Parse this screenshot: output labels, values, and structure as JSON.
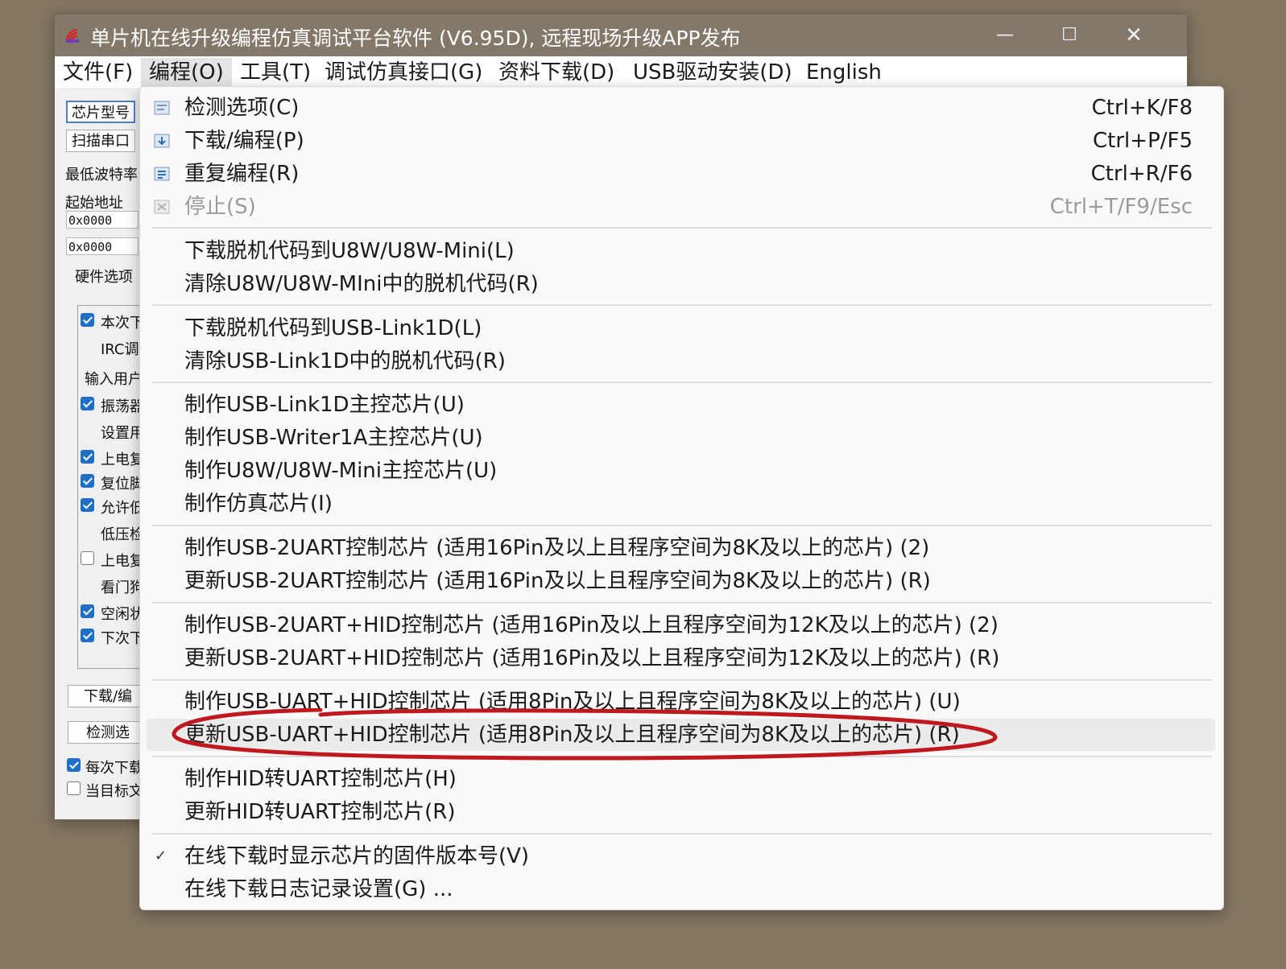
{
  "window": {
    "title": "单片机在线升级编程仿真调试平台软件 (V6.95D), 远程现场升级APP发布",
    "controls": {
      "minimize": "—",
      "maximize": "☐",
      "close": "✕"
    }
  },
  "menubar": [
    {
      "label": "文件(F)"
    },
    {
      "label": "编程(O)"
    },
    {
      "label": "工具(T)"
    },
    {
      "label": "调试仿真接口(G)"
    },
    {
      "label": "资料下载(D)"
    },
    {
      "label": "USB驱动安装(D)"
    },
    {
      "label": "English"
    }
  ],
  "panel": {
    "chip_model_button": "芯片型号",
    "scan_port_button": "扫描串口",
    "min_baud_label": "最低波特率",
    "start_address_label": "起始地址",
    "address1": "0x0000",
    "address2": "0x0000",
    "hardware_options_label": "硬件选项",
    "options": [
      {
        "text": "本次下",
        "checked": true
      },
      {
        "text": "IRC调",
        "checked": null
      },
      {
        "text": "输入用户",
        "checked": null
      },
      {
        "text": "振荡器",
        "checked": true
      },
      {
        "text": "设置用",
        "checked": null
      },
      {
        "text": "上电复",
        "checked": true
      },
      {
        "text": "复位脚",
        "checked": true
      },
      {
        "text": "允许低",
        "checked": true
      },
      {
        "text": "低压检",
        "checked": null
      },
      {
        "text": "上电复",
        "checked": false
      },
      {
        "text": "看门狗",
        "checked": null
      },
      {
        "text": "空闲状",
        "checked": true
      },
      {
        "text": "下次下",
        "checked": true
      }
    ],
    "download_button": "下载/编",
    "detect_button": "检测选",
    "every_download_check": "每次下载",
    "every_download_checked": true,
    "target_file_check": "当目标文",
    "target_file_checked": false
  },
  "dropdown": {
    "items": [
      {
        "label": "检测选项(C)",
        "shortcut": "Ctrl+K/F8",
        "icon": "detect-icon"
      },
      {
        "label": "下载/编程(P)",
        "shortcut": "Ctrl+P/F5",
        "icon": "download-icon"
      },
      {
        "label": "重复编程(R)",
        "shortcut": "Ctrl+R/F6",
        "icon": "repeat-program-icon"
      },
      {
        "label": "停止(S)",
        "shortcut": "Ctrl+T/F9/Esc",
        "icon": "stop-icon",
        "disabled": true
      },
      {
        "label": "下载脱机代码到U8W/U8W-Mini(L)"
      },
      {
        "label": "清除U8W/U8W-MIni中的脱机代码(R)"
      },
      {
        "label": "下载脱机代码到USB-Link1D(L)"
      },
      {
        "label": "清除USB-Link1D中的脱机代码(R)"
      },
      {
        "label": "制作USB-Link1D主控芯片(U)"
      },
      {
        "label": "制作USB-Writer1A主控芯片(U)"
      },
      {
        "label": "制作U8W/U8W-Mini主控芯片(U)"
      },
      {
        "label": "制作仿真芯片(I)"
      },
      {
        "label": "制作USB-2UART控制芯片 (适用16Pin及以上且程序空间为8K及以上的芯片) (2)"
      },
      {
        "label": "更新USB-2UART控制芯片 (适用16Pin及以上且程序空间为8K及以上的芯片) (R)"
      },
      {
        "label": "制作USB-2UART+HID控制芯片 (适用16Pin及以上且程序空间为12K及以上的芯片) (2)"
      },
      {
        "label": "更新USB-2UART+HID控制芯片 (适用16Pin及以上且程序空间为12K及以上的芯片) (R)"
      },
      {
        "label": "制作USB-UART+HID控制芯片 (适用8Pin及以上且程序空间为8K及以上的芯片) (U)"
      },
      {
        "label": "更新USB-UART+HID控制芯片 (适用8Pin及以上且程序空间为8K及以上的芯片) (R)",
        "highlighted": true
      },
      {
        "label": "制作HID转UART控制芯片(H)"
      },
      {
        "label": "更新HID转UART控制芯片(R)"
      },
      {
        "label": "在线下载时显示芯片的固件版本号(V)",
        "checked": true
      },
      {
        "label": "在线下载日志记录设置(G) ..."
      }
    ]
  },
  "colors": {
    "desktop": "#847762",
    "titlebar": "#84786a",
    "menu_background": "#f9f9f9",
    "annotation_stroke": "#c0181f",
    "checkbox_on": "#1f6fc5"
  }
}
